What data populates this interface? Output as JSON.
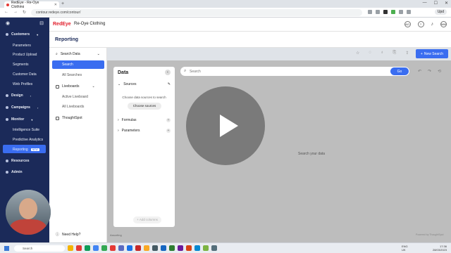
{
  "browser": {
    "tab_title": "RedEye - Re-Oye Clothing",
    "url": "contour.redeye.com/contour/",
    "profile_label": "Upd"
  },
  "app": {
    "logo": "RedEye",
    "workspace": "Re-Oye Clothing",
    "avatar_initials_1": "AO",
    "avatar_initials_2": "MM"
  },
  "leftnav": {
    "customers": "Customers",
    "parameters": "Parameters",
    "product_upload": "Product Upload",
    "segments": "Segments",
    "customer_data": "Customer Data",
    "web_profiles": "Web Profiles",
    "design": "Design",
    "campaigns": "Campaigns",
    "monitor": "Monitor",
    "intelligence_suite": "Intelligence Suite",
    "predictive_analytics": "Predictive Analytics",
    "reporting": "Reporting",
    "reporting_badge": "NEW",
    "resources": "Resources",
    "admin": "Admin"
  },
  "page": {
    "title": "Reporting",
    "new_search": "New Search"
  },
  "reporting_sidebar": {
    "search_data": "Search Data",
    "search": "Search",
    "all_searches": "All Searches",
    "liveboards": "Liveboards",
    "active_liveboard": "Active Liveboard",
    "all_liveboards": "All Liveboards",
    "thoughtspot": "ThoughtSpot",
    "need_help": "Need Help?"
  },
  "data_panel": {
    "title": "Data",
    "sources": "Sources",
    "hint": "Choose data sources to search",
    "choose_sources": "Choose sources",
    "formulas": "Formulas",
    "parameters": "Parameters",
    "add_columns": "Add columns"
  },
  "search": {
    "placeholder": "Search",
    "go": "Go",
    "empty_state": "Search your data"
  },
  "footer": {
    "left": "Assorting",
    "right": "Powered by ThoughtSpot"
  },
  "taskbar": {
    "search": "Search",
    "lang1": "ENG",
    "lang2": "UK",
    "time": "17:36",
    "date": "28/03/2023"
  }
}
